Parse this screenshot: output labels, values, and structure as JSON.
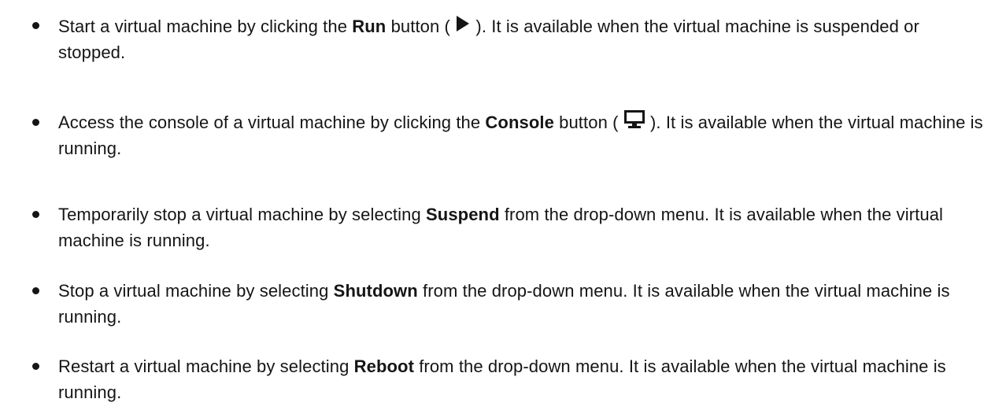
{
  "items": [
    {
      "pre": "Start a virtual machine by clicking the ",
      "bold": "Run",
      "mid": " button ( ",
      "icon": "play-icon",
      "post": " ). It is available when the virtual machine is suspended or stopped."
    },
    {
      "pre": "Access the console of a virtual machine by clicking the ",
      "bold": "Console",
      "mid": " button ( ",
      "icon": "monitor-icon",
      "post": " ). It is available when the virtual machine is running."
    },
    {
      "pre": "Temporarily stop a virtual machine by selecting ",
      "bold": "Suspend",
      "post": " from the drop-down menu. It is available when the virtual machine is running."
    },
    {
      "pre": "Stop a virtual machine by selecting ",
      "bold": "Shutdown",
      "post": " from the drop-down menu. It is available when the virtual machine is running."
    },
    {
      "pre": "Restart a virtual machine by selecting ",
      "bold": "Reboot",
      "post": " from the drop-down menu. It is available when the virtual machine is running."
    }
  ]
}
